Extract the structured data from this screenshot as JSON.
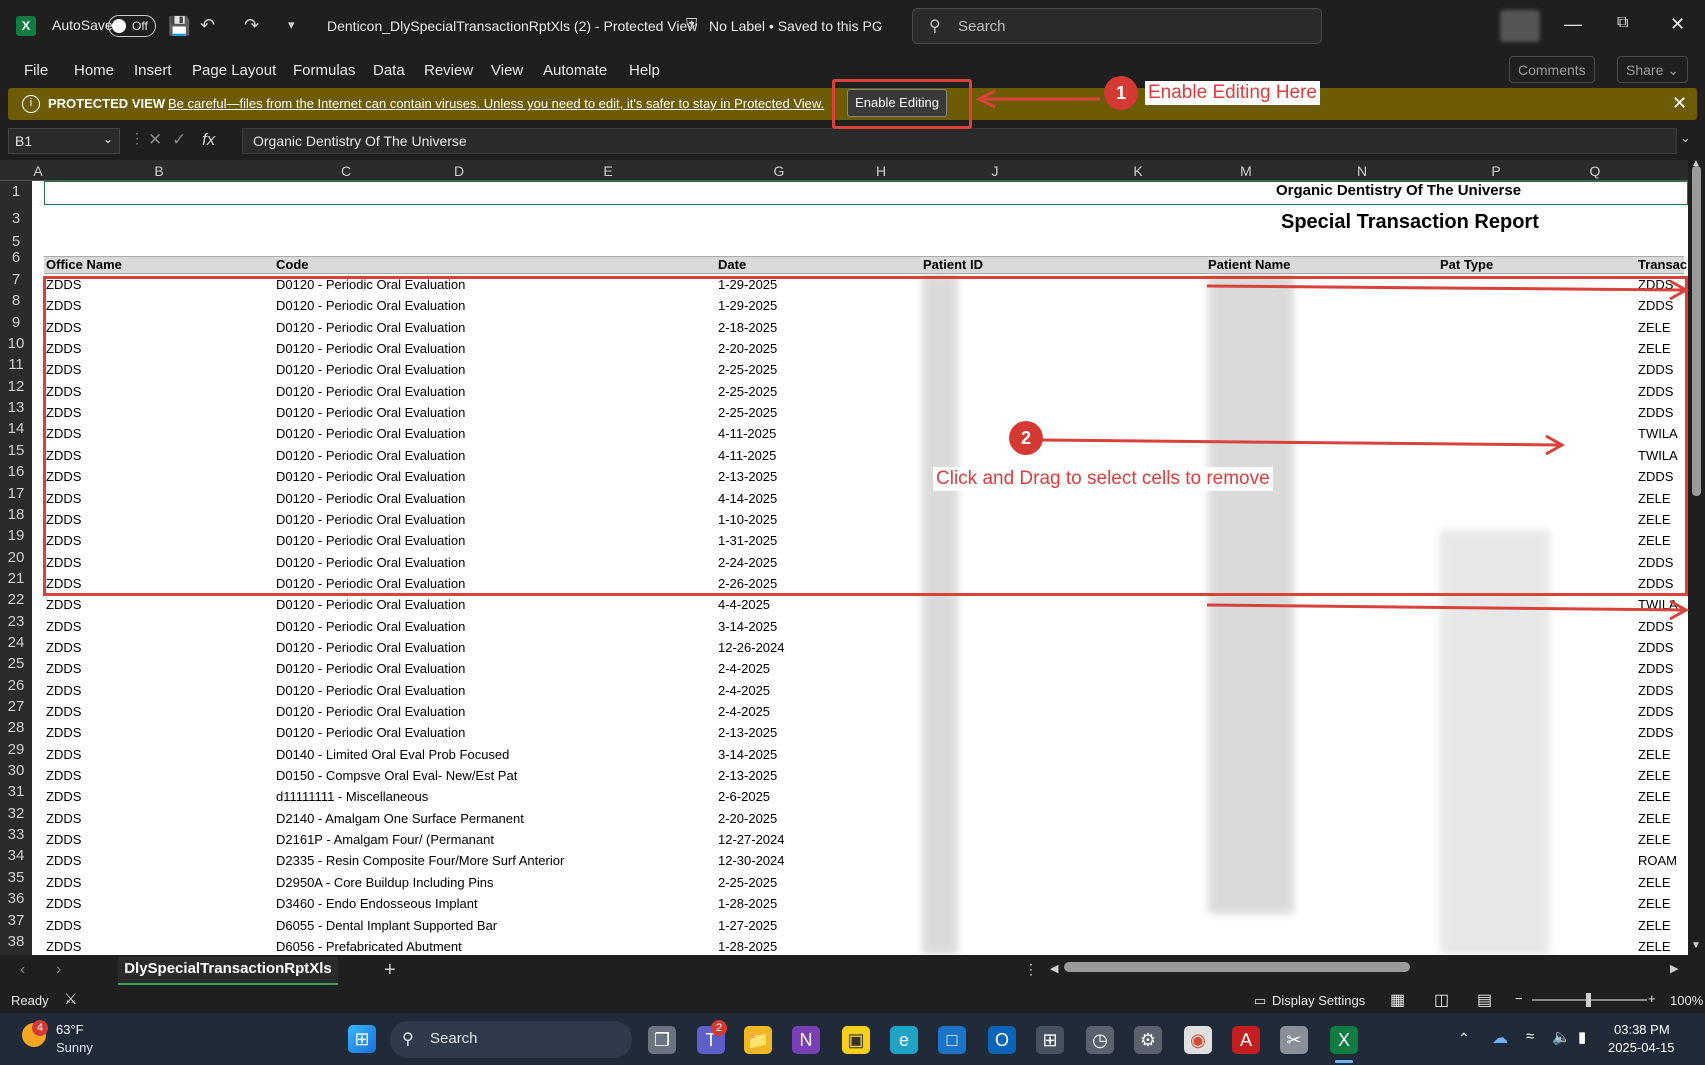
{
  "window": {
    "app_letter": "X",
    "autosave_label": "AutoSave",
    "autosave_state": "Off",
    "title": "Denticon_DlySpecialTransactionRptXls (2)  -  Protected View",
    "label_status": "No Label • Saved to this PC",
    "search_placeholder": "Search"
  },
  "menu": [
    "File",
    "Home",
    "Insert",
    "Page Layout",
    "Formulas",
    "Data",
    "Review",
    "View",
    "Automate",
    "Help"
  ],
  "comments_label": "Comments",
  "share_label": "Share",
  "protected_view": {
    "title": "PROTECTED VIEW",
    "message": "Be careful—files from the Internet can contain viruses. Unless you need to edit, it's safer to stay in Protected View.",
    "enable_button": "Enable Editing"
  },
  "formula_bar": {
    "name_box": "B1",
    "formula": "Organic Dentistry Of The Universe"
  },
  "columns": [
    "A",
    "B",
    "C",
    "D",
    "E",
    "G",
    "H",
    "J",
    "K",
    "M",
    "N",
    "P",
    "Q"
  ],
  "report": {
    "org_name": "Organic Dentistry Of The Universe",
    "title": "Special Transaction Report",
    "headers": [
      "Office Name",
      "Code",
      "Date",
      "Patient ID",
      "Patient  Name",
      "Pat Type",
      "Transac"
    ]
  },
  "row_numbers": [
    "1",
    "3",
    "5",
    "6",
    "7",
    "8",
    "9",
    "10",
    "11",
    "12",
    "13",
    "14",
    "15",
    "16",
    "17",
    "18",
    "19",
    "20",
    "21",
    "22",
    "23",
    "24",
    "25",
    "26",
    "27",
    "28",
    "29",
    "30",
    "31",
    "32",
    "33",
    "34",
    "35",
    "36",
    "37",
    "38"
  ],
  "rows": [
    {
      "office": "ZDDS",
      "code": "D0120 - Periodic Oral Evaluation",
      "date": "1-29-2025",
      "trans": "ZDDS"
    },
    {
      "office": "ZDDS",
      "code": "D0120 - Periodic Oral Evaluation",
      "date": "1-29-2025",
      "trans": "ZDDS"
    },
    {
      "office": "ZDDS",
      "code": "D0120 - Periodic Oral Evaluation",
      "date": "2-18-2025",
      "trans": "ZELE"
    },
    {
      "office": "ZDDS",
      "code": "D0120 - Periodic Oral Evaluation",
      "date": "2-20-2025",
      "trans": "ZELE"
    },
    {
      "office": "ZDDS",
      "code": "D0120 - Periodic Oral Evaluation",
      "date": "2-25-2025",
      "trans": "ZDDS"
    },
    {
      "office": "ZDDS",
      "code": "D0120 - Periodic Oral Evaluation",
      "date": "2-25-2025",
      "trans": "ZDDS"
    },
    {
      "office": "ZDDS",
      "code": "D0120 - Periodic Oral Evaluation",
      "date": "2-25-2025",
      "trans": "ZDDS"
    },
    {
      "office": "ZDDS",
      "code": "D0120 - Periodic Oral Evaluation",
      "date": "4-11-2025",
      "trans": "TWILA"
    },
    {
      "office": "ZDDS",
      "code": "D0120 - Periodic Oral Evaluation",
      "date": "4-11-2025",
      "trans": "TWILA"
    },
    {
      "office": "ZDDS",
      "code": "D0120 - Periodic Oral Evaluation",
      "date": "2-13-2025",
      "trans": "ZDDS"
    },
    {
      "office": "ZDDS",
      "code": "D0120 - Periodic Oral Evaluation",
      "date": "4-14-2025",
      "trans": "ZELE"
    },
    {
      "office": "ZDDS",
      "code": "D0120 - Periodic Oral Evaluation",
      "date": "1-10-2025",
      "trans": "ZELE"
    },
    {
      "office": "ZDDS",
      "code": "D0120 - Periodic Oral Evaluation",
      "date": "1-31-2025",
      "trans": "ZELE"
    },
    {
      "office": "ZDDS",
      "code": "D0120 - Periodic Oral Evaluation",
      "date": "2-24-2025",
      "trans": "ZDDS"
    },
    {
      "office": "ZDDS",
      "code": "D0120 - Periodic Oral Evaluation",
      "date": "2-26-2025",
      "trans": "ZDDS"
    },
    {
      "office": "ZDDS",
      "code": "D0120 - Periodic Oral Evaluation",
      "date": "4-4-2025",
      "trans": "TWILA"
    },
    {
      "office": "ZDDS",
      "code": "D0120 - Periodic Oral Evaluation",
      "date": "3-14-2025",
      "trans": "ZDDS"
    },
    {
      "office": "ZDDS",
      "code": "D0120 - Periodic Oral Evaluation",
      "date": "12-26-2024",
      "trans": "ZDDS"
    },
    {
      "office": "ZDDS",
      "code": "D0120 - Periodic Oral Evaluation",
      "date": "2-4-2025",
      "trans": "ZDDS"
    },
    {
      "office": "ZDDS",
      "code": "D0120 - Periodic Oral Evaluation",
      "date": "2-4-2025",
      "trans": "ZDDS"
    },
    {
      "office": "ZDDS",
      "code": "D0120 - Periodic Oral Evaluation",
      "date": "2-4-2025",
      "trans": "ZDDS"
    },
    {
      "office": "ZDDS",
      "code": "D0120 - Periodic Oral Evaluation",
      "date": "2-13-2025",
      "trans": "ZDDS"
    },
    {
      "office": "ZDDS",
      "code": "D0140 - Limited Oral Eval Prob Focused",
      "date": "3-14-2025",
      "trans": "ZELE"
    },
    {
      "office": "ZDDS",
      "code": "D0150 - Compsve Oral Eval- New/Est Pat",
      "date": "2-13-2025",
      "trans": "ZELE"
    },
    {
      "office": "ZDDS",
      "code": "d11111111 - Miscellaneous",
      "date": "2-6-2025",
      "trans": "ZELE"
    },
    {
      "office": "ZDDS",
      "code": "D2140 - Amalgam One Surface Permanent",
      "date": "2-20-2025",
      "trans": "ZELE"
    },
    {
      "office": "ZDDS",
      "code": "D2161P - Amalgam Four/ (Permanant",
      "date": "12-27-2024",
      "trans": "ZELE"
    },
    {
      "office": "ZDDS",
      "code": "D2335 - Resin Composite Four/More Surf Anterior",
      "date": "12-30-2024",
      "trans": "ROAM"
    },
    {
      "office": "ZDDS",
      "code": "D2950A - Core Buildup Including Pins",
      "date": "2-25-2025",
      "trans": "ZELE"
    },
    {
      "office": "ZDDS",
      "code": "D3460 - Endo Endosseous Implant",
      "date": "1-28-2025",
      "trans": "ZELE"
    },
    {
      "office": "ZDDS",
      "code": "D6055 - Dental Implant Supported Bar",
      "date": "1-27-2025",
      "trans": "ZELE"
    },
    {
      "office": "ZDDS",
      "code": "D6056 - Prefabricated Abutment",
      "date": "1-28-2025",
      "trans": "ZELE"
    }
  ],
  "annotations": {
    "step1_number": "1",
    "step1_text": "Enable Editing Here",
    "step2_number": "2",
    "step2_text": "Click and Drag to select cells to remove",
    "color": "#e23b3b"
  },
  "sheet_tab": "DlySpecialTransactionRptXls",
  "status": {
    "ready": "Ready",
    "display_settings": "Display Settings",
    "zoom": "100%"
  },
  "taskbar": {
    "weather_badge": "4",
    "weather_temp": "63°F",
    "weather_desc": "Sunny",
    "search": "Search",
    "teams_badge": "2",
    "time": "03:38 PM",
    "date": "2025-04-15"
  }
}
